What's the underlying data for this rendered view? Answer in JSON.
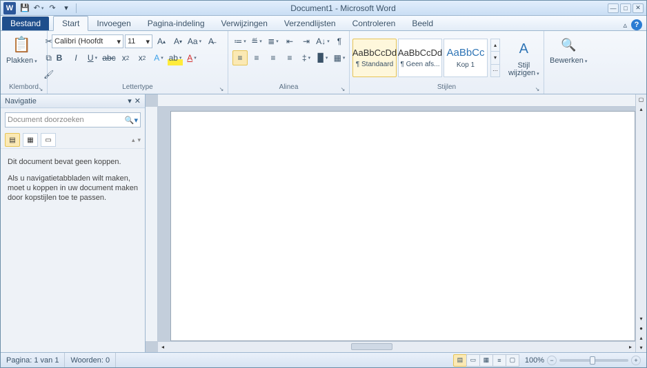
{
  "title": "Document1 - Microsoft Word",
  "tabs": {
    "bestand": "Bestand",
    "start": "Start",
    "invoegen": "Invoegen",
    "pagina": "Pagina-indeling",
    "verwijzingen": "Verwijzingen",
    "verzendlijsten": "Verzendlijsten",
    "controleren": "Controleren",
    "beeld": "Beeld"
  },
  "ribbon": {
    "klembord": {
      "label": "Klembord",
      "plakken": "Plakken"
    },
    "lettertype": {
      "label": "Lettertype",
      "font": "Calibri (Hoofdt",
      "size": "11"
    },
    "alinea": {
      "label": "Alinea"
    },
    "stijlen": {
      "label": "Stijlen",
      "items": [
        {
          "preview": "AaBbCcDd",
          "name": "¶ Standaard"
        },
        {
          "preview": "AaBbCcDd",
          "name": "¶ Geen afs..."
        },
        {
          "preview": "AaBbCc",
          "name": "Kop 1"
        }
      ],
      "wijzigen": "Stijl wijzigen"
    },
    "bewerken": {
      "label": "Bewerken"
    }
  },
  "nav": {
    "title": "Navigatie",
    "search_placeholder": "Document doorzoeken",
    "msg1": "Dit document bevat geen koppen.",
    "msg2": "Als u navigatietabbladen wilt maken, moet u koppen in uw document maken door kopstijlen toe te passen."
  },
  "status": {
    "page": "Pagina: 1 van 1",
    "words": "Woorden: 0",
    "zoom": "100%"
  }
}
